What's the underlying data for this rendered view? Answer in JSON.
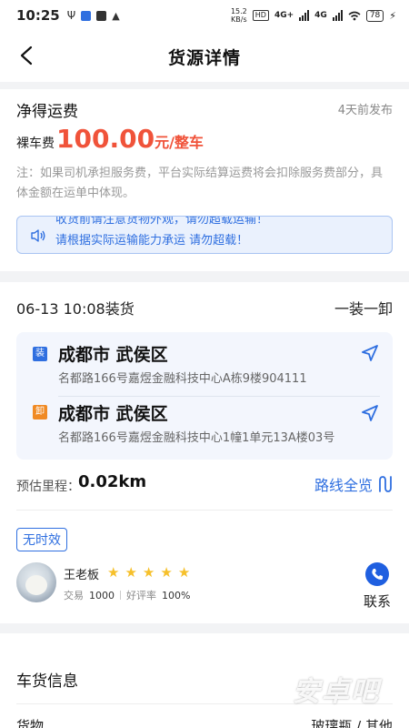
{
  "status_bar": {
    "time": "10:25",
    "speed_top": "15.2",
    "speed_bottom": "KB/s",
    "hd": "HD",
    "net1": "4G+",
    "net2": "4G",
    "battery": "78"
  },
  "navbar": {
    "title": "货源详情"
  },
  "freight": {
    "title": "净得运费",
    "published": "4天前发布",
    "price_label": "裸车费",
    "price_value": "100.00",
    "price_unit": "元/整车",
    "note": "注：如果司机承担服务费，平台实际结算运费将会扣除服务费部分，具体金额在运单中体现。",
    "notice_prev": "收货前请注意货物外观，请勿超载运输！",
    "notice_text": "请根据实际运输能力承运   请勿超载！",
    "notice_color": "#2f6fe0",
    "price_color": "#f0533a"
  },
  "route": {
    "load_time": "06-13 10:08装货",
    "load_type": "一装一卸",
    "origin": {
      "tag": "装",
      "city": "成都市 武侯区",
      "address": "名都路166号嘉煜金融科技中心A栋9楼904111",
      "tag_color": "#2f6fe0"
    },
    "destination": {
      "tag": "卸",
      "city": "成都市 武侯区",
      "address": "名都路166号嘉煜金融科技中心1幢1单元13A楼03号",
      "tag_color": "#f08a24"
    },
    "distance_label": "预估里程：",
    "distance_value": "0.02km",
    "overview_label": "路线全览"
  },
  "shipper": {
    "time_tag": "无时效",
    "name": "王老板",
    "rating_stars": 5,
    "trade_label": "交易",
    "trade_count": "1000",
    "rate_label": "好评率",
    "rate_value": "100%",
    "contact_label": "联系",
    "avatar_icon": "dog-photo"
  },
  "cargo": {
    "title": "车货信息",
    "row_label": "货物",
    "row_value": "玻璃瓶 / 其他"
  },
  "watermark": "安卓吧"
}
